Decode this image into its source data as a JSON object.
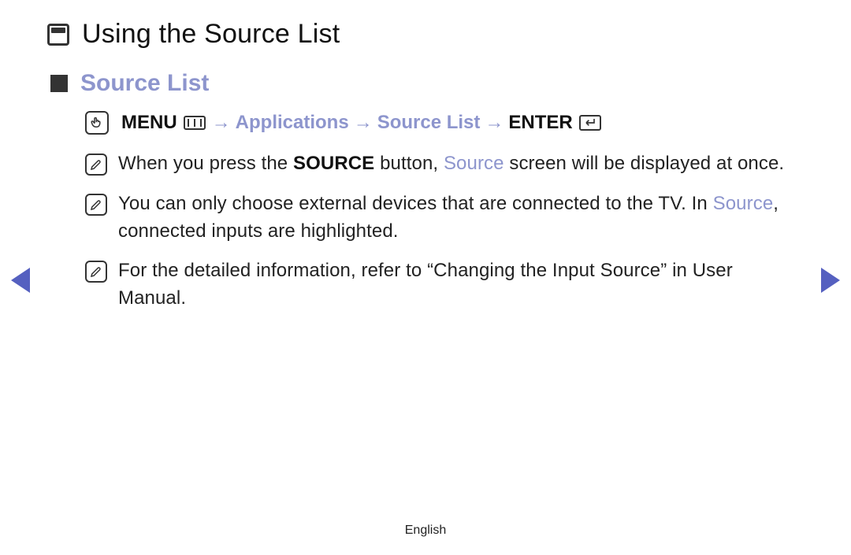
{
  "page": {
    "title": "Using the Source List",
    "section_title": "Source List",
    "language": "English"
  },
  "nav_path": {
    "menu_label": "MENU",
    "sep": "→",
    "step1": "Applications",
    "step2": "Source List",
    "enter_label": "ENTER"
  },
  "notes": {
    "n1": {
      "pre": "When you press the ",
      "bold": "SOURCE",
      "mid": " button, ",
      "blue": "Source",
      "post": " screen will be displayed at once."
    },
    "n2": {
      "pre": "You can only choose external devices that are connected to the TV. In ",
      "blue": "Source",
      "post": ", connected inputs are highlighted."
    },
    "n3": {
      "text": "For the detailed information, refer to “Changing the Input Source” in User Manual."
    }
  }
}
